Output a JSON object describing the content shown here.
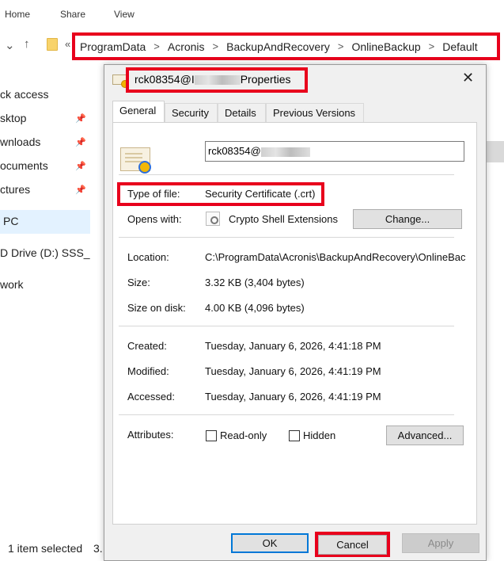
{
  "ribbon": {
    "tabs": [
      "Home",
      "Share",
      "View"
    ]
  },
  "address": {
    "overflow": "«",
    "crumbs": [
      "ProgramData",
      "Acronis",
      "BackupAndRecovery",
      "OnlineBackup",
      "Default"
    ],
    "separator": ">"
  },
  "nav_pane": {
    "items": [
      "ck access",
      "sktop",
      "wnloads",
      "ocuments",
      "ctures",
      "PC",
      "D Drive (D:) SSS_X",
      "work"
    ],
    "pin_glyph": "📌"
  },
  "status_bar": {
    "selected": "1 item selected",
    "size_fragment": "3."
  },
  "dialog": {
    "title_prefix": "rck08354@",
    "title_mid": "I",
    "title_suffix": "Properties",
    "close": "✕",
    "tabs": [
      "General",
      "Security",
      "Details",
      "Previous Versions"
    ],
    "file_name": "rck08354@",
    "type_label": "Type of file:",
    "type_value": "Security Certificate (.crt)",
    "opens_label": "Opens with:",
    "opens_value": "Crypto Shell Extensions",
    "change_button": "Change...",
    "location_label": "Location:",
    "location_value": "C:\\ProgramData\\Acronis\\BackupAndRecovery\\OnlineBackup\\Default",
    "size_label": "Size:",
    "size_value": "3.32 KB (3,404 bytes)",
    "size_on_disk_label": "Size on disk:",
    "size_on_disk_value": "4.00 KB (4,096 bytes)",
    "created_label": "Created:",
    "created_value": "Tuesday, January 6, 2026, 4:41:18 PM",
    "modified_label": "Modified:",
    "modified_value": "Tuesday, January 6, 2026, 4:41:19 PM",
    "accessed_label": "Accessed:",
    "accessed_value": "Tuesday, January 6, 2026, 4:41:19 PM",
    "attributes_label": "Attributes:",
    "readonly_label": "Read-only",
    "hidden_label": "Hidden",
    "advanced_button": "Advanced...",
    "ok_button": "OK",
    "cancel_button": "Cancel",
    "apply_button": "Apply"
  },
  "colors": {
    "highlight": "#e8001c",
    "focus": "#0078d7",
    "selection": "#cce8ff"
  }
}
